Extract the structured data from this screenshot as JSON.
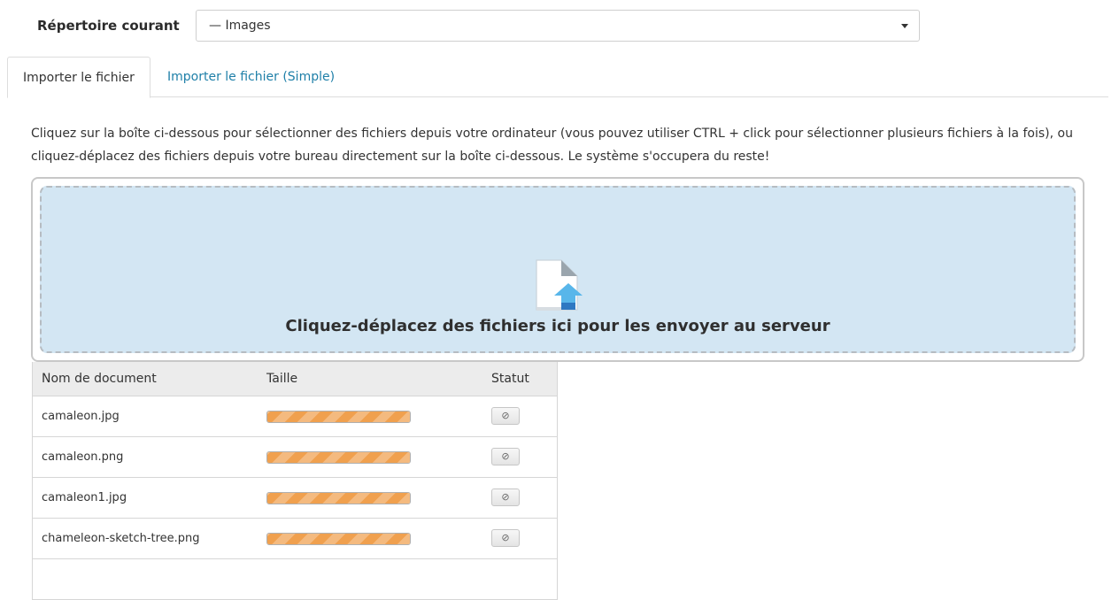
{
  "directory": {
    "label": "Répertoire courant",
    "selected": "— Images"
  },
  "tabs": [
    {
      "label": "Importer le fichier",
      "active": true
    },
    {
      "label": "Importer le fichier (Simple)",
      "active": false
    }
  ],
  "help_text": "Cliquez sur la boîte ci-dessous pour sélectionner des fichiers depuis votre ordinateur (vous pouvez utiliser CTRL + click pour sélectionner plusieurs fichiers à la fois), ou cliquez-déplacez des fichiers depuis votre bureau directement sur la boîte ci-dessous. Le système s'occupera du reste!",
  "dropzone": {
    "text": "Cliquez-déplacez des fichiers ici pour les envoyer au serveur",
    "icon": "file-upload-icon"
  },
  "table": {
    "headers": {
      "name": "Nom de document",
      "size": "Taille",
      "status": "Statut"
    },
    "rows": [
      {
        "name": "camaleon.jpg",
        "progress": 1.0,
        "status_icon": "cancel-icon"
      },
      {
        "name": "camaleon.png",
        "progress": 1.0,
        "status_icon": "cancel-icon"
      },
      {
        "name": "camaleon1.jpg",
        "progress": 1.0,
        "status_icon": "cancel-icon"
      },
      {
        "name": "chameleon-sketch-tree.png",
        "progress": 1.0,
        "status_icon": "cancel-icon"
      }
    ]
  },
  "colors": {
    "link": "#1e7fa8",
    "dropzone_bg": "#d3e6f3",
    "progress_fill": "#f0a04e"
  }
}
